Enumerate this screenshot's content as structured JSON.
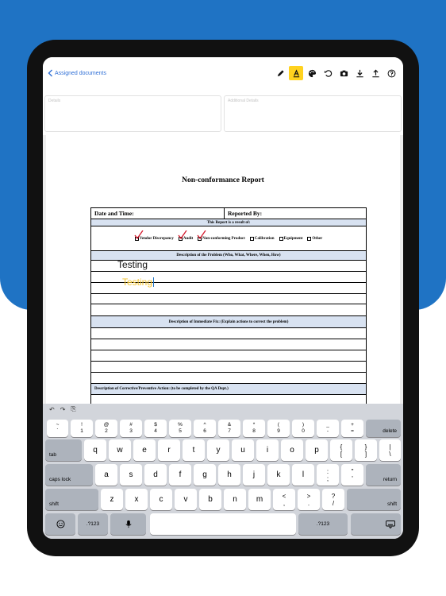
{
  "topbar": {
    "back_label": "Assigned documents",
    "tools": [
      "pencil-icon",
      "highlighter-icon",
      "palette-icon",
      "undo-icon",
      "camera-icon",
      "download-icon",
      "upload-icon",
      "help-icon"
    ],
    "accent": "#ffd21f",
    "link_color": "#2f6fd6"
  },
  "fields": {
    "details_placeholder": "Details",
    "additional_placeholder": "Additional Details"
  },
  "document": {
    "title": "Non-conformance Report",
    "date_label": "Date and Time:",
    "reported_by_label": "Reported By:",
    "result_header": "This Report is a result of:",
    "checkboxes": [
      {
        "label": "Vendor Discrepancy",
        "checked": true
      },
      {
        "label": "Audit",
        "checked": true
      },
      {
        "label": "Non-conforming Product",
        "checked": true
      },
      {
        "label": "Calibration",
        "checked": false
      },
      {
        "label": "Equipment",
        "checked": false
      },
      {
        "label": "Other",
        "checked": false
      }
    ],
    "problem_header": "Description of the Problem (Who, What, Where, When, How)",
    "handwriting_1": "Testing",
    "handwriting_2": "Testing",
    "fix_header": "Description of Immediate Fix: (Explain actions to correct the problem)",
    "corrective_header": "Description of Corrective/Preventive Action: (to be completed by the QA Dept.)"
  },
  "keyboard": {
    "toolbar": [
      "↶",
      "↷",
      "⎘"
    ],
    "num_row": [
      [
        "~",
        "`"
      ],
      [
        "!",
        "1"
      ],
      [
        "@",
        "2"
      ],
      [
        "#",
        "3"
      ],
      [
        "$",
        "4"
      ],
      [
        "%",
        "5"
      ],
      [
        "^",
        "6"
      ],
      [
        "&",
        "7"
      ],
      [
        "*",
        "8"
      ],
      [
        "(",
        "9"
      ],
      [
        ")",
        "0"
      ],
      [
        "_",
        "-"
      ],
      [
        "+",
        "="
      ]
    ],
    "delete": "delete",
    "tab": "tab",
    "row_q": [
      "q",
      "w",
      "e",
      "r",
      "t",
      "y",
      "u",
      "i",
      "o",
      "p"
    ],
    "row_q_extra": [
      [
        "{",
        "["
      ],
      [
        "}",
        "]"
      ],
      [
        "|",
        "\\"
      ]
    ],
    "caps": "caps lock",
    "row_a": [
      "a",
      "s",
      "d",
      "f",
      "g",
      "h",
      "j",
      "k",
      "l"
    ],
    "row_a_extra": [
      [
        ":",
        ";"
      ],
      [
        "\"",
        "'"
      ]
    ],
    "return": "return",
    "shift": "shift",
    "row_z": [
      "z",
      "x",
      "c",
      "v",
      "b",
      "n",
      "m"
    ],
    "row_z_extra": [
      [
        "<",
        ","
      ],
      [
        ">",
        "."
      ],
      [
        "?",
        "/"
      ]
    ],
    "num_label": ".?123",
    "bottom_icons": [
      "emoji-icon",
      "microphone-icon",
      "keyboard-dismiss-icon"
    ]
  }
}
